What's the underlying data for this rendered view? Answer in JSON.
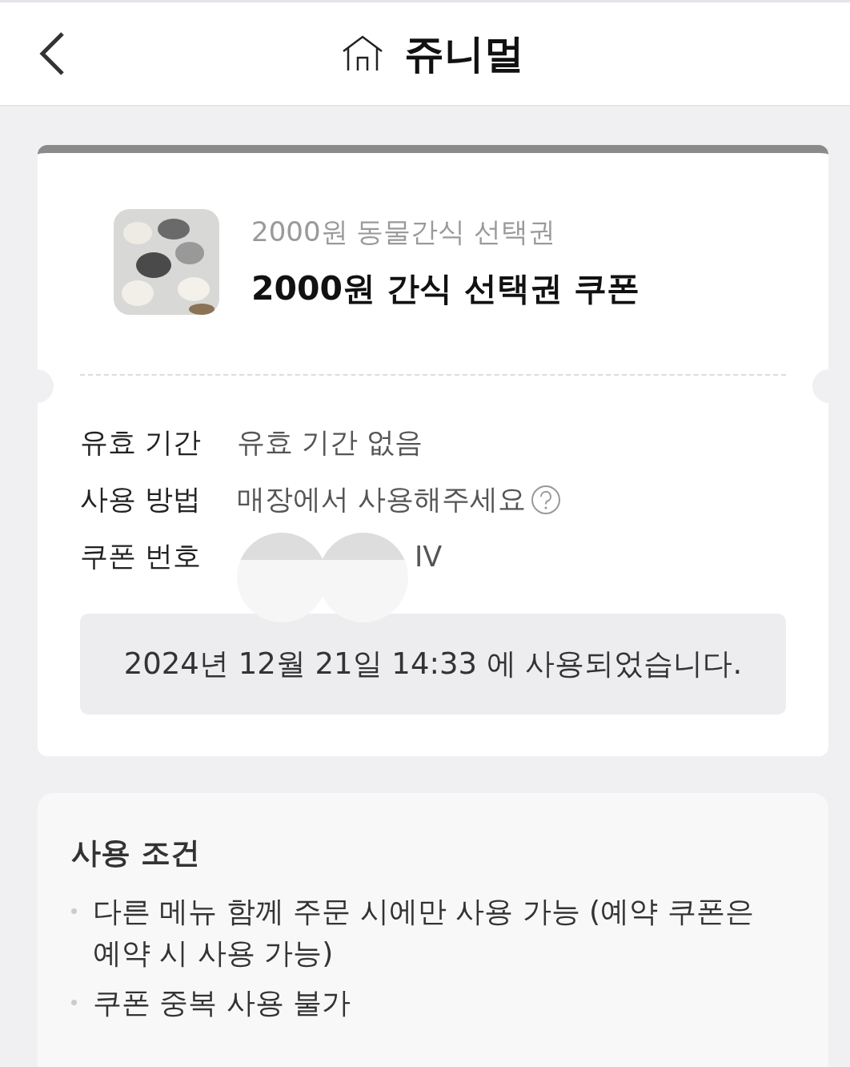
{
  "header": {
    "title": "쥬니멀"
  },
  "coupon": {
    "subtitle": "2000원 동물간식 선택권",
    "title": "2000원 간식 선택권 쿠폰",
    "details": [
      {
        "label": "유효 기간",
        "value": "유효 기간 없음",
        "kind": "text"
      },
      {
        "label": "사용 방법",
        "value": "매장에서 사용해주세요",
        "kind": "help"
      },
      {
        "label": "쿠폰 번호",
        "value": "IV",
        "kind": "redacted"
      }
    ],
    "used_notice": "2024년 12월 21일 14:33 에 사용되었습니다."
  },
  "conditions": {
    "title": "사용 조건",
    "items": [
      "다른 메뉴 함께 주문 시에만 사용 가능 (예약 쿠폰은 예약 시 사용 가능)",
      "쿠폰 중복 사용 불가"
    ]
  }
}
